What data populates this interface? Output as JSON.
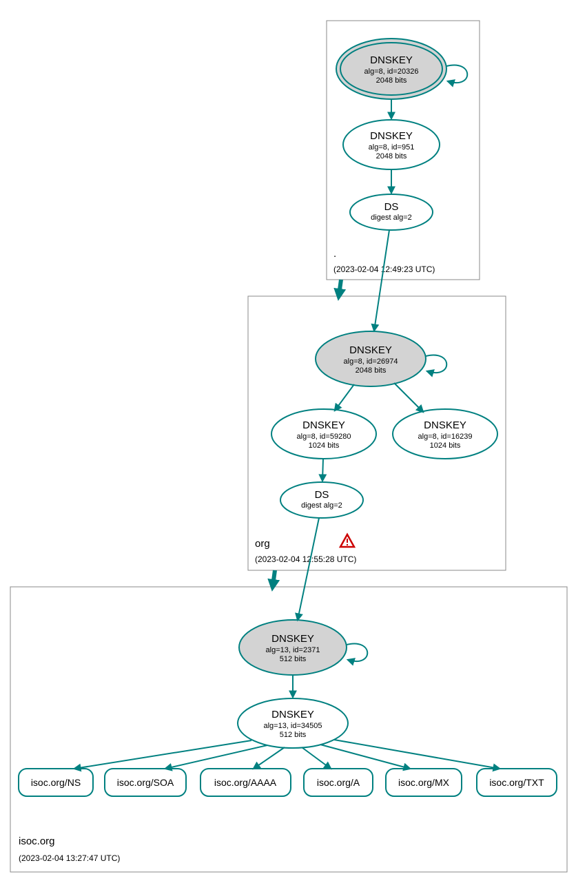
{
  "zones": {
    "root": {
      "label": ".",
      "timestamp": "(2023-02-04 12:49:23 UTC)",
      "has_warning": false
    },
    "org": {
      "label": "org",
      "timestamp": "(2023-02-04 12:55:28 UTC)",
      "has_warning": true
    },
    "isoc": {
      "label": "isoc.org",
      "timestamp": "(2023-02-04 13:27:47 UTC)",
      "has_warning": false
    }
  },
  "nodes": {
    "root_ksk": {
      "title": "DNSKEY",
      "line1": "alg=8, id=20326",
      "line2": "2048 bits"
    },
    "root_zsk": {
      "title": "DNSKEY",
      "line1": "alg=8, id=951",
      "line2": "2048 bits"
    },
    "root_ds": {
      "title": "DS",
      "line1": "digest alg=2"
    },
    "org_ksk": {
      "title": "DNSKEY",
      "line1": "alg=8, id=26974",
      "line2": "2048 bits"
    },
    "org_zsk1": {
      "title": "DNSKEY",
      "line1": "alg=8, id=59280",
      "line2": "1024 bits"
    },
    "org_zsk2": {
      "title": "DNSKEY",
      "line1": "alg=8, id=16239",
      "line2": "1024 bits"
    },
    "org_ds": {
      "title": "DS",
      "line1": "digest alg=2"
    },
    "isoc_ksk": {
      "title": "DNSKEY",
      "line1": "alg=13, id=2371",
      "line2": "512 bits"
    },
    "isoc_zsk": {
      "title": "DNSKEY",
      "line1": "alg=13, id=34505",
      "line2": "512 bits"
    }
  },
  "rrsets": {
    "ns": "isoc.org/NS",
    "soa": "isoc.org/SOA",
    "aaaa": "isoc.org/AAAA",
    "a": "isoc.org/A",
    "mx": "isoc.org/MX",
    "txt": "isoc.org/TXT"
  }
}
